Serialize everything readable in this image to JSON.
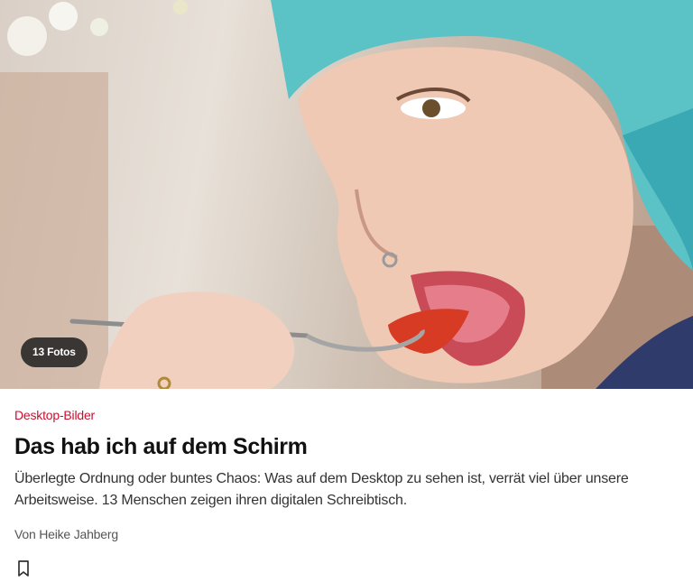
{
  "hero": {
    "photo_count_label": "13 Fotos",
    "image_alt": "Frau mit türkisen Haaren isst mit einem Löffel"
  },
  "article": {
    "kicker": "Desktop-Bilder",
    "headline": "Das hab ich auf dem Schirm",
    "teaser": "Überlegte Ordnung oder buntes Chaos: Was auf dem Desktop zu sehen ist, verrät viel über unsere Arbeitsweise. 13 Menschen zeigen ihren digitalen Schreibtisch.",
    "byline": "Von Heike Jahberg"
  },
  "colors": {
    "kicker": "#c8102e",
    "hair": "#4fc1c8"
  },
  "icons": {
    "bookmark": "bookmark-icon"
  }
}
